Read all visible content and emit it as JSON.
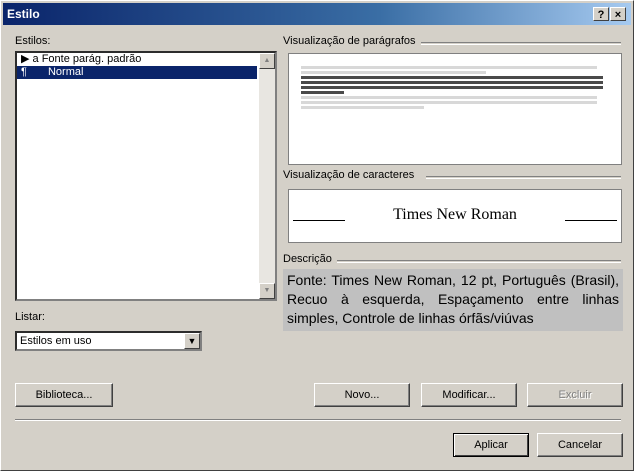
{
  "window": {
    "title": "Estilo",
    "help_glyph": "?",
    "close_glyph": "×"
  },
  "styles": {
    "label": "Estilos:",
    "items": [
      {
        "label": "Fonte parág. padrão",
        "marker": "▶ a",
        "selected": false
      },
      {
        "label": "Normal",
        "marker": "¶",
        "selected": true
      }
    ]
  },
  "list_filter": {
    "label": "Listar:",
    "value": "Estilos em uso"
  },
  "paragraph_preview": {
    "label": "Visualização de parágrafos"
  },
  "character_preview": {
    "label": "Visualização de caracteres",
    "sample": "Times New Roman"
  },
  "description": {
    "label": "Descrição",
    "text": "Fonte: Times New Roman, 12 pt, Português (Brasil), Recuo à esquerda, Espaçamento entre linhas simples, Controle de linhas órfãs/viúvas"
  },
  "buttons": {
    "library": "Biblioteca...",
    "new": "Novo...",
    "modify": "Modificar...",
    "delete": "Excluir",
    "apply": "Aplicar",
    "cancel": "Cancelar"
  }
}
